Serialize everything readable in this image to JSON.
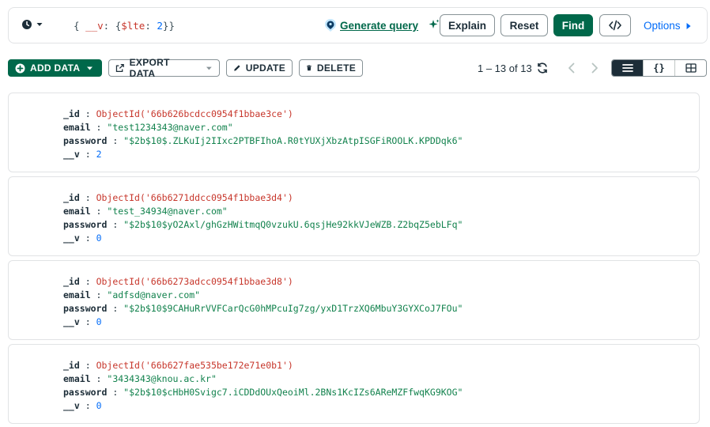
{
  "query_bar": {
    "filter": {
      "open_brace": "{ ",
      "key": "__v",
      "colon": ": {",
      "operator": "$lte",
      "op_colon": ": ",
      "value": "2",
      "close": "}}"
    },
    "generate_query_label": "Generate query",
    "explain_label": "Explain",
    "reset_label": "Reset",
    "find_label": "Find",
    "options_label": "Options"
  },
  "toolbar": {
    "add_data_label": "ADD DATA",
    "export_data_label": "EXPORT DATA",
    "update_label": "UPDATE",
    "delete_label": "DELETE",
    "pagination": "1 – 13 of 13",
    "json_view_label": "{}"
  },
  "colors": {
    "brand_green": "#00684a",
    "link_blue": "#016bf8",
    "objectid_red": "#c7362b",
    "string_green": "#12824d"
  },
  "documents": [
    {
      "id_key": "_id",
      "id_value": "ObjectId('66b626bcdcc0954f1bbae3ce')",
      "email_key": "email",
      "email_value": "\"test1234343@naver.com\"",
      "password_key": "password",
      "password_value": "\"$2b$10$.ZLKuIj2IIxc2PTBFIhoA.R0tYUXjXbzAtpISGFiROOLK.KPDDqk6\"",
      "v_key": "__v",
      "v_value": "2"
    },
    {
      "id_key": "_id",
      "id_value": "ObjectId('66b6271ddcc0954f1bbae3d4')",
      "email_key": "email",
      "email_value": "\"test_34934@naver.com\"",
      "password_key": "password",
      "password_value": "\"$2b$10$yO2Axl/ghGzHWitmqQ0vzukU.6qsjHe92kkVJeWZB.Z2bqZ5ebLFq\"",
      "v_key": "__v",
      "v_value": "0"
    },
    {
      "id_key": "_id",
      "id_value": "ObjectId('66b6273adcc0954f1bbae3d8')",
      "email_key": "email",
      "email_value": "\"adfsd@naver.com\"",
      "password_key": "password",
      "password_value": "\"$2b$10$9CAHuRrVVFCarQcG0hMPcuIg7zg/yxD1TrzXQ6MbuY3GYXCoJ7FOu\"",
      "v_key": "__v",
      "v_value": "0"
    },
    {
      "id_key": "_id",
      "id_value": "ObjectId('66b627fae535be172e71e0b1')",
      "email_key": "email",
      "email_value": "\"3434343@knou.ac.kr\"",
      "password_key": "password",
      "password_value": "\"$2b$10$cHbH0Svigc7.iCDDdOUxQeoiMl.2BNs1KcIZs6AReMZFfwqKG9KOG\"",
      "v_key": "__v",
      "v_value": "0"
    }
  ]
}
